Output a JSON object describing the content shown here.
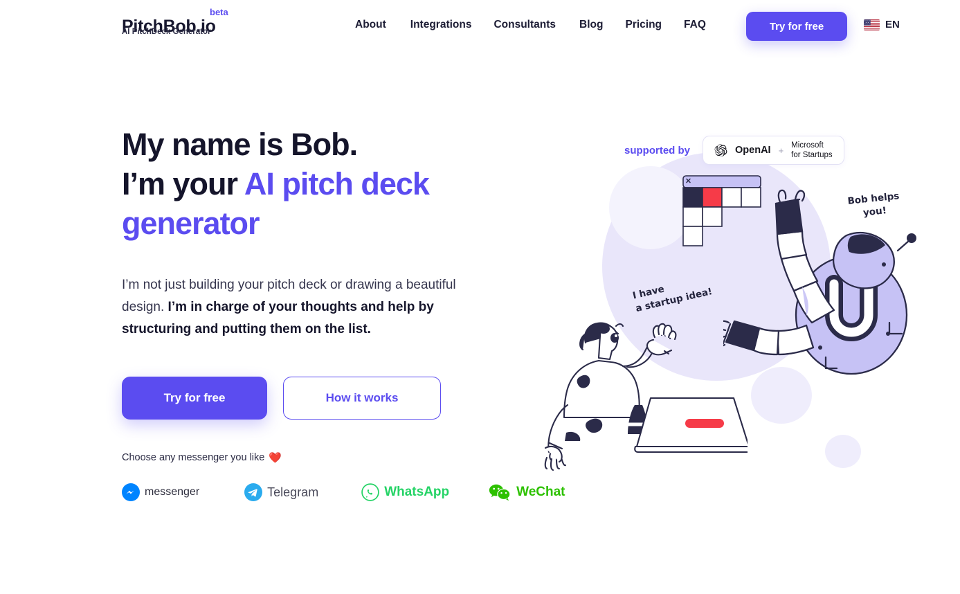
{
  "header": {
    "logo": {
      "title": "PitchBob.io",
      "subtitle": "AI PitchDeck Generator",
      "badge": "beta"
    },
    "nav": [
      {
        "label": "About"
      },
      {
        "label": "Integrations"
      },
      {
        "label": "Consultants"
      },
      {
        "label": "Blog"
      },
      {
        "label": "Pricing"
      },
      {
        "label": "FAQ"
      }
    ],
    "cta_label": "Try for free",
    "language": {
      "code": "EN",
      "flag": "us-flag-icon"
    }
  },
  "hero": {
    "headline_line1": "My name is Bob.",
    "headline_line2_plain": "I’m your ",
    "headline_line2_accent": "AI pitch deck",
    "headline_line3_accent": "generator",
    "lead_plain": "I’m not just building your pitch deck or drawing a beautiful design. ",
    "lead_bold": "I’m in charge of your thoughts and help by structuring and putting them on the list.",
    "primary_cta": "Try for free",
    "secondary_cta": "How it works",
    "messenger_title": "Choose any messenger you like",
    "messenger_heart": "❤️",
    "messengers": [
      {
        "name": "messenger",
        "label": "messenger"
      },
      {
        "name": "telegram",
        "label": "Telegram"
      },
      {
        "name": "whatsapp",
        "label": "WhatsApp"
      },
      {
        "name": "wechat",
        "label": "WeChat"
      }
    ]
  },
  "supported": {
    "label": "supported by",
    "openai": "OpenAI",
    "plus": "+",
    "microsoft_line1": "Microsoft",
    "microsoft_line2": "for Startups"
  },
  "illustration": {
    "bubble_person_line1": "I have",
    "bubble_person_line2": "a startup idea!",
    "bubble_robot_line1": "Bob helps",
    "bubble_robot_line2": "you!",
    "window_close": "×"
  },
  "colors": {
    "accent": "#5b4cf0",
    "ink": "#15152b",
    "red": "#f63b48",
    "navy": "#2b2b49",
    "lavender": "#c6c2f5",
    "blob": "#eeecfb",
    "whatsapp": "#25D366",
    "wechat": "#2DC100",
    "telegram": "#2AABEE",
    "messenger": "#0084FF"
  }
}
